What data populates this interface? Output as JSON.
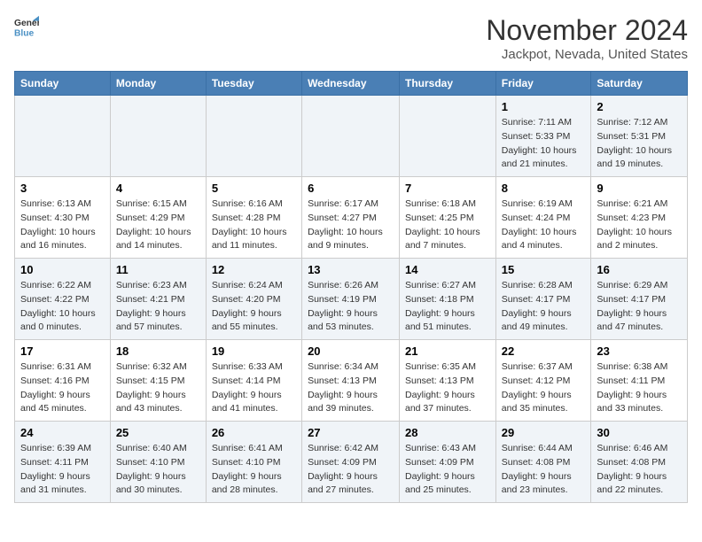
{
  "logo": {
    "line1": "General",
    "line2": "Blue"
  },
  "title": "November 2024",
  "location": "Jackpot, Nevada, United States",
  "weekdays": [
    "Sunday",
    "Monday",
    "Tuesday",
    "Wednesday",
    "Thursday",
    "Friday",
    "Saturday"
  ],
  "weeks": [
    [
      {
        "day": "",
        "info": ""
      },
      {
        "day": "",
        "info": ""
      },
      {
        "day": "",
        "info": ""
      },
      {
        "day": "",
        "info": ""
      },
      {
        "day": "",
        "info": ""
      },
      {
        "day": "1",
        "info": "Sunrise: 7:11 AM\nSunset: 5:33 PM\nDaylight: 10 hours and 21 minutes."
      },
      {
        "day": "2",
        "info": "Sunrise: 7:12 AM\nSunset: 5:31 PM\nDaylight: 10 hours and 19 minutes."
      }
    ],
    [
      {
        "day": "3",
        "info": "Sunrise: 6:13 AM\nSunset: 4:30 PM\nDaylight: 10 hours and 16 minutes."
      },
      {
        "day": "4",
        "info": "Sunrise: 6:15 AM\nSunset: 4:29 PM\nDaylight: 10 hours and 14 minutes."
      },
      {
        "day": "5",
        "info": "Sunrise: 6:16 AM\nSunset: 4:28 PM\nDaylight: 10 hours and 11 minutes."
      },
      {
        "day": "6",
        "info": "Sunrise: 6:17 AM\nSunset: 4:27 PM\nDaylight: 10 hours and 9 minutes."
      },
      {
        "day": "7",
        "info": "Sunrise: 6:18 AM\nSunset: 4:25 PM\nDaylight: 10 hours and 7 minutes."
      },
      {
        "day": "8",
        "info": "Sunrise: 6:19 AM\nSunset: 4:24 PM\nDaylight: 10 hours and 4 minutes."
      },
      {
        "day": "9",
        "info": "Sunrise: 6:21 AM\nSunset: 4:23 PM\nDaylight: 10 hours and 2 minutes."
      }
    ],
    [
      {
        "day": "10",
        "info": "Sunrise: 6:22 AM\nSunset: 4:22 PM\nDaylight: 10 hours and 0 minutes."
      },
      {
        "day": "11",
        "info": "Sunrise: 6:23 AM\nSunset: 4:21 PM\nDaylight: 9 hours and 57 minutes."
      },
      {
        "day": "12",
        "info": "Sunrise: 6:24 AM\nSunset: 4:20 PM\nDaylight: 9 hours and 55 minutes."
      },
      {
        "day": "13",
        "info": "Sunrise: 6:26 AM\nSunset: 4:19 PM\nDaylight: 9 hours and 53 minutes."
      },
      {
        "day": "14",
        "info": "Sunrise: 6:27 AM\nSunset: 4:18 PM\nDaylight: 9 hours and 51 minutes."
      },
      {
        "day": "15",
        "info": "Sunrise: 6:28 AM\nSunset: 4:17 PM\nDaylight: 9 hours and 49 minutes."
      },
      {
        "day": "16",
        "info": "Sunrise: 6:29 AM\nSunset: 4:17 PM\nDaylight: 9 hours and 47 minutes."
      }
    ],
    [
      {
        "day": "17",
        "info": "Sunrise: 6:31 AM\nSunset: 4:16 PM\nDaylight: 9 hours and 45 minutes."
      },
      {
        "day": "18",
        "info": "Sunrise: 6:32 AM\nSunset: 4:15 PM\nDaylight: 9 hours and 43 minutes."
      },
      {
        "day": "19",
        "info": "Sunrise: 6:33 AM\nSunset: 4:14 PM\nDaylight: 9 hours and 41 minutes."
      },
      {
        "day": "20",
        "info": "Sunrise: 6:34 AM\nSunset: 4:13 PM\nDaylight: 9 hours and 39 minutes."
      },
      {
        "day": "21",
        "info": "Sunrise: 6:35 AM\nSunset: 4:13 PM\nDaylight: 9 hours and 37 minutes."
      },
      {
        "day": "22",
        "info": "Sunrise: 6:37 AM\nSunset: 4:12 PM\nDaylight: 9 hours and 35 minutes."
      },
      {
        "day": "23",
        "info": "Sunrise: 6:38 AM\nSunset: 4:11 PM\nDaylight: 9 hours and 33 minutes."
      }
    ],
    [
      {
        "day": "24",
        "info": "Sunrise: 6:39 AM\nSunset: 4:11 PM\nDaylight: 9 hours and 31 minutes."
      },
      {
        "day": "25",
        "info": "Sunrise: 6:40 AM\nSunset: 4:10 PM\nDaylight: 9 hours and 30 minutes."
      },
      {
        "day": "26",
        "info": "Sunrise: 6:41 AM\nSunset: 4:10 PM\nDaylight: 9 hours and 28 minutes."
      },
      {
        "day": "27",
        "info": "Sunrise: 6:42 AM\nSunset: 4:09 PM\nDaylight: 9 hours and 27 minutes."
      },
      {
        "day": "28",
        "info": "Sunrise: 6:43 AM\nSunset: 4:09 PM\nDaylight: 9 hours and 25 minutes."
      },
      {
        "day": "29",
        "info": "Sunrise: 6:44 AM\nSunset: 4:08 PM\nDaylight: 9 hours and 23 minutes."
      },
      {
        "day": "30",
        "info": "Sunrise: 6:46 AM\nSunset: 4:08 PM\nDaylight: 9 hours and 22 minutes."
      }
    ]
  ]
}
